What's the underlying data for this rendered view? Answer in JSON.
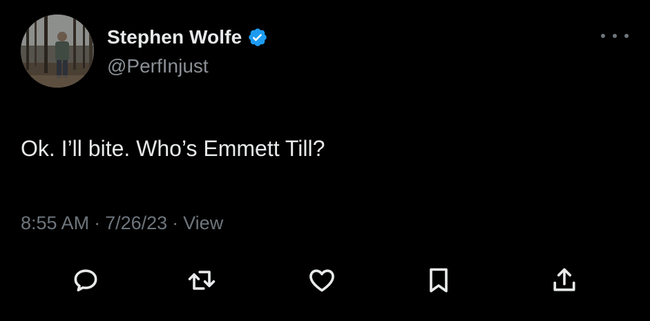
{
  "user": {
    "display_name": "Stephen Wolfe",
    "handle": "@PerfInjust",
    "verified": true
  },
  "tweet": {
    "text": "Ok. I’ll bite. Who’s Emmett Till?",
    "time": "8:55 AM",
    "date": "7/26/23",
    "views_label": "View",
    "separator": "·"
  },
  "actions": [
    {
      "icon": "reply-icon"
    },
    {
      "icon": "retweet-icon"
    },
    {
      "icon": "like-icon"
    },
    {
      "icon": "bookmark-icon"
    },
    {
      "icon": "share-icon"
    }
  ],
  "colors": {
    "background": "#000000",
    "primary_text": "#e7e9ea",
    "secondary_text": "#6e767d",
    "verified_badge": "#1d9bf0"
  }
}
